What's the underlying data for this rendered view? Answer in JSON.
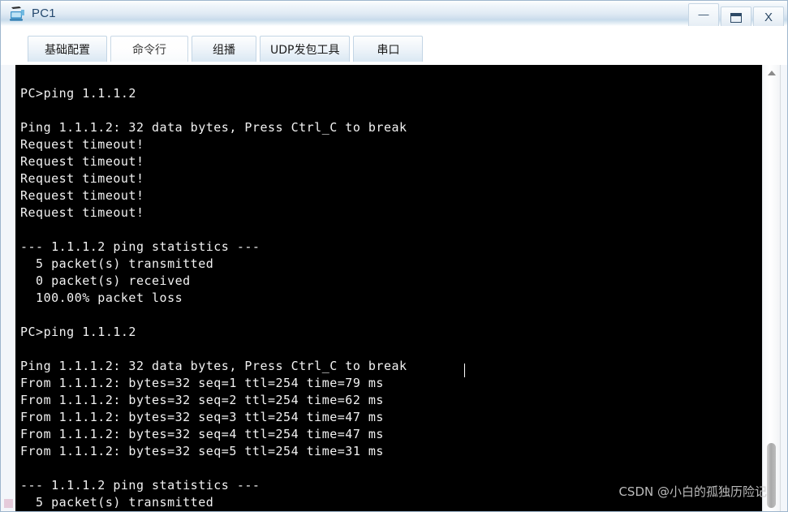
{
  "window": {
    "title": "PC1",
    "icon": "pc-icon",
    "controls": [
      {
        "name": "minimize-button",
        "glyph": "—"
      },
      {
        "name": "maximize-button",
        "glyph": "❐"
      },
      {
        "name": "close-button",
        "glyph": "X"
      }
    ]
  },
  "tabs": [
    {
      "label": "基础配置",
      "active": false
    },
    {
      "label": "命令行",
      "active": true
    },
    {
      "label": "组播",
      "active": false
    },
    {
      "label": "UDP发包工具",
      "active": false
    },
    {
      "label": "串口",
      "active": false
    }
  ],
  "terminal": {
    "lines": [
      "",
      "PC>ping 1.1.1.2",
      "",
      "Ping 1.1.1.2: 32 data bytes, Press Ctrl_C to break",
      "Request timeout!",
      "Request timeout!",
      "Request timeout!",
      "Request timeout!",
      "Request timeout!",
      "",
      "--- 1.1.1.2 ping statistics ---",
      "  5 packet(s) transmitted",
      "  0 packet(s) received",
      "  100.00% packet loss",
      "",
      "PC>ping 1.1.1.2",
      "",
      "Ping 1.1.1.2: 32 data bytes, Press Ctrl_C to break",
      "From 1.1.1.2: bytes=32 seq=1 ttl=254 time=79 ms",
      "From 1.1.1.2: bytes=32 seq=2 ttl=254 time=62 ms",
      "From 1.1.1.2: bytes=32 seq=3 ttl=254 time=47 ms",
      "From 1.1.1.2: bytes=32 seq=4 ttl=254 time=47 ms",
      "From 1.1.1.2: bytes=32 seq=5 ttl=254 time=31 ms",
      "",
      "--- 1.1.1.2 ping statistics ---",
      "  5 packet(s) transmitted"
    ],
    "background_color": "#000000",
    "text_color": "#f2f2f2"
  },
  "scrollbar": {
    "up_arrow": "scroll-up-arrow-icon"
  },
  "watermark": {
    "text": "CSDN @小白的孤独历险记"
  }
}
